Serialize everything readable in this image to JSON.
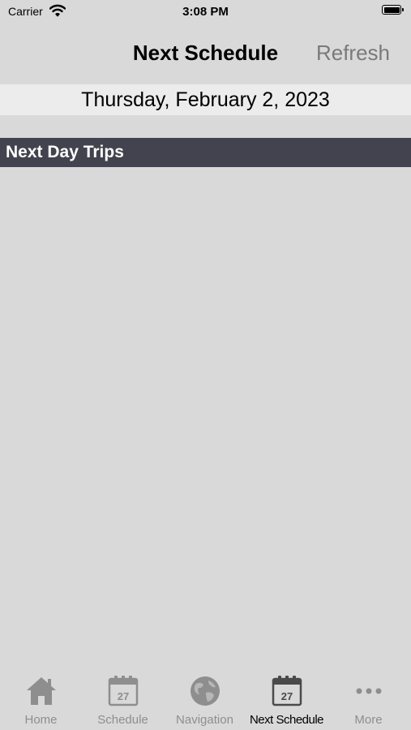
{
  "status_bar": {
    "carrier": "Carrier",
    "time": "3:08 PM"
  },
  "nav": {
    "title": "Next Schedule",
    "refresh_label": "Refresh"
  },
  "date_label": "Thursday, February 2, 2023",
  "section": {
    "title": "Next Day Trips"
  },
  "trips": [],
  "tabs": [
    {
      "label": "Home",
      "icon": "home-icon",
      "active": false
    },
    {
      "label": "Schedule",
      "icon": "calendar-icon",
      "calendar_day": "27",
      "active": false
    },
    {
      "label": "Navigation",
      "icon": "globe-icon",
      "active": false
    },
    {
      "label": "Next Schedule",
      "icon": "calendar-icon",
      "calendar_day": "27",
      "active": true
    },
    {
      "label": "More",
      "icon": "more-icon",
      "active": false
    }
  ],
  "colors": {
    "background": "#d9d9d9",
    "date_bar": "#ececec",
    "section_header": "#43434f",
    "tab_inactive": "#8e8e8e",
    "tab_active": "#000000",
    "refresh": "#7a7a7a"
  }
}
